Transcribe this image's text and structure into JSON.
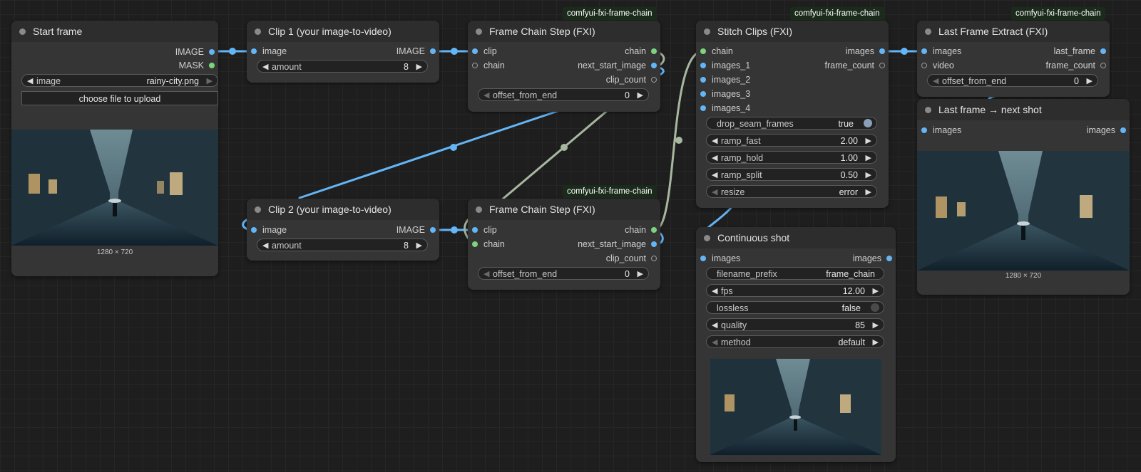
{
  "badge": "comfyui-fxi-frame-chain",
  "preview_size": "1280 × 720",
  "nodes": {
    "start_frame": {
      "title": "Start frame",
      "outputs": [
        "IMAGE",
        "MASK"
      ],
      "image_label": "image",
      "image_value": "rainy-city.png",
      "upload_label": "choose file to upload"
    },
    "clip1": {
      "title": "Clip 1 (your image-to-video)",
      "input": "image",
      "output": "IMAGE",
      "amount_label": "amount",
      "amount_value": "8"
    },
    "clip2": {
      "title": "Clip 2 (your image-to-video)",
      "input": "image",
      "output": "IMAGE",
      "amount_label": "amount",
      "amount_value": "8"
    },
    "fcs1": {
      "title": "Frame Chain Step (FXI)",
      "inputs": [
        "clip",
        "chain"
      ],
      "outputs": [
        "chain",
        "next_start_image",
        "clip_count"
      ],
      "offset_label": "offset_from_end",
      "offset_value": "0"
    },
    "fcs2": {
      "title": "Frame Chain Step (FXI)",
      "inputs": [
        "clip",
        "chain"
      ],
      "outputs": [
        "chain",
        "next_start_image",
        "clip_count"
      ],
      "offset_label": "offset_from_end",
      "offset_value": "0"
    },
    "stitch": {
      "title": "Stitch Clips (FXI)",
      "inputs": [
        "chain",
        "images_1",
        "images_2",
        "images_3",
        "images_4"
      ],
      "outputs": [
        "images",
        "frame_count"
      ],
      "widgets": [
        {
          "label": "drop_seam_frames",
          "value": "true"
        },
        {
          "label": "ramp_fast",
          "value": "2.00"
        },
        {
          "label": "ramp_hold",
          "value": "1.00"
        },
        {
          "label": "ramp_split",
          "value": "0.50"
        },
        {
          "label": "resize",
          "value": "error"
        }
      ]
    },
    "lfe": {
      "title": "Last Frame Extract (FXI)",
      "inputs": [
        "images",
        "video"
      ],
      "outputs": [
        "last_frame",
        "frame_count"
      ],
      "offset_label": "offset_from_end",
      "offset_value": "0"
    },
    "next_shot": {
      "title": "Last frame → next shot",
      "input": "images",
      "output": "images"
    },
    "continuous": {
      "title": "Continuous shot",
      "input": "images",
      "output": "images",
      "widgets": [
        {
          "label": "filename_prefix",
          "value": "frame_chain"
        },
        {
          "label": "fps",
          "value": "12.00"
        },
        {
          "label": "lossless",
          "value": "false"
        },
        {
          "label": "quality",
          "value": "85"
        },
        {
          "label": "method",
          "value": "default"
        }
      ]
    }
  },
  "colors": {
    "image_link": "#64b5f6",
    "chain_link": "#a8b8a0",
    "chain_slot": "#7ed37e",
    "node_bg": "#353535",
    "title_bg": "#2d2d2d",
    "canvas_bg": "#1e1e1e"
  }
}
